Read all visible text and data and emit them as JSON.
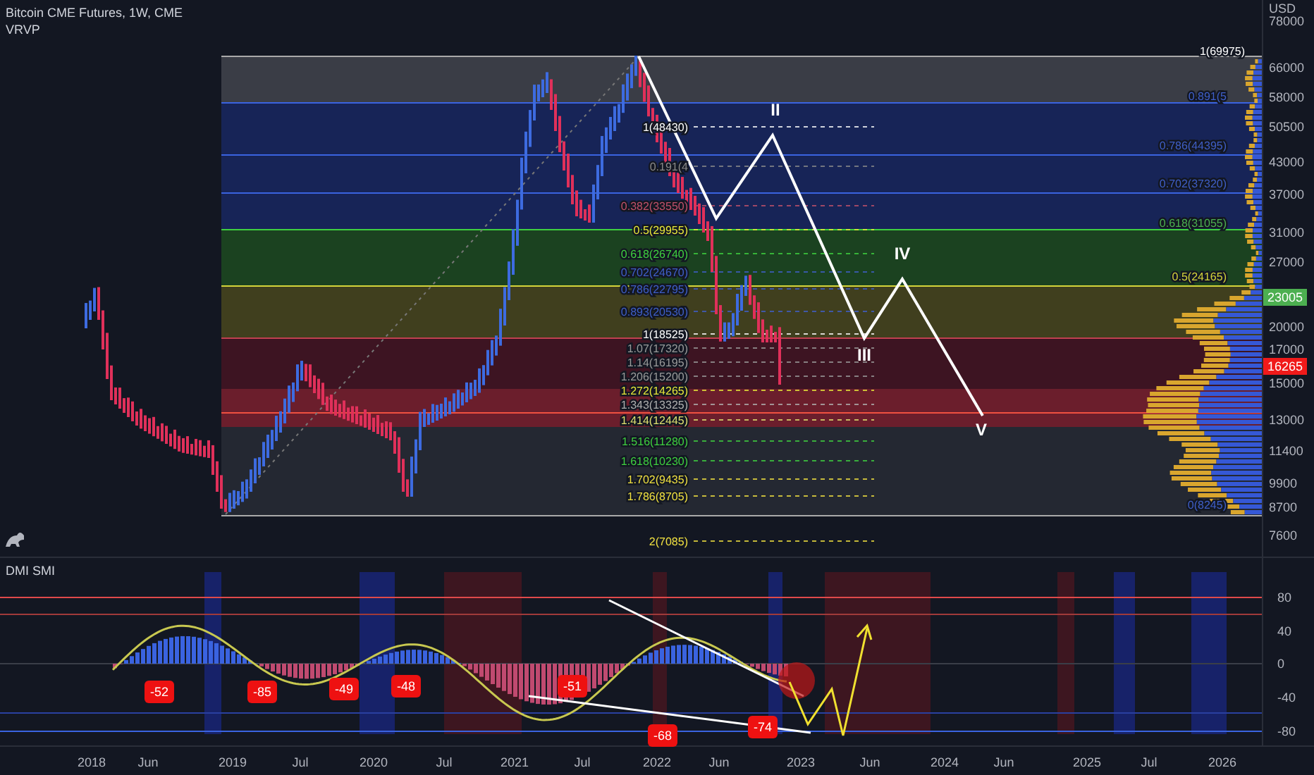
{
  "main_chart": {
    "title": "Bitcoin CME Futures, 1W, CME",
    "indicator": "VRVP",
    "outer_fib_labels": [
      {
        "text": "1(69975)",
        "color": "#ffffff"
      },
      {
        "text": "0.891(5",
        "color": "#3f5fc8"
      },
      {
        "text": "0.786(44395)",
        "color": "#3f5fc8"
      },
      {
        "text": "0.702(37320)",
        "color": "#3f5fc8"
      },
      {
        "text": "0.618(31055)",
        "color": "#4caf50"
      },
      {
        "text": "0.5(24165)",
        "color": "#d4d43a"
      },
      {
        "text": "0(8245)",
        "color": "#3f5fc8"
      }
    ],
    "inner_fib_labels": [
      {
        "text": "1(48430)",
        "color": "#ffffff"
      },
      {
        "text": "0.191(4",
        "color": "#8a8a8a"
      },
      {
        "text": "0.382(33550)",
        "color": "#c0506a"
      },
      {
        "text": "0.5(29955)",
        "color": "#e8e83a"
      },
      {
        "text": "0.618(26740)",
        "color": "#3fd03f"
      },
      {
        "text": "0.702(24670)",
        "color": "#3f5fc8"
      },
      {
        "text": "0.786(22795)",
        "color": "#3f5fc8"
      },
      {
        "text": "0.893(20530)",
        "color": "#3f5fc8"
      },
      {
        "text": "1(18525)",
        "color": "#ffffff"
      },
      {
        "text": "1.07(17320)",
        "color": "#9a9a9a"
      },
      {
        "text": "1.14(16195)",
        "color": "#9a9a9a"
      },
      {
        "text": "1.206(15200)",
        "color": "#9a9a9a"
      },
      {
        "text": "1.272(14265)",
        "color": "#e8e83a"
      },
      {
        "text": "1.343(13325)",
        "color": "#b0b0b0"
      },
      {
        "text": "1.414(12445)",
        "color": "#e0e070"
      },
      {
        "text": "1.516(11280)",
        "color": "#3fd03f"
      },
      {
        "text": "1.618(10230)",
        "color": "#3fd03f"
      },
      {
        "text": "1.702(9435)",
        "color": "#f0e040"
      },
      {
        "text": "1.786(8705)",
        "color": "#f0e040"
      },
      {
        "text": "2(7085)",
        "color": "#f0e040"
      }
    ],
    "wave_labels": [
      "II",
      "III",
      "IV",
      "V"
    ],
    "price_axis": {
      "unit": "USD",
      "ticks": [
        "78000",
        "66000",
        "58000",
        "50500",
        "43000",
        "37000",
        "31000",
        "27000",
        "20000",
        "17000",
        "15000",
        "13000",
        "11400",
        "9900",
        "8700",
        "7600"
      ],
      "badges": [
        {
          "text": "23005",
          "color": "#4caf50"
        },
        {
          "text": "16265",
          "color": "#f01a1a"
        }
      ]
    }
  },
  "indicator_pane": {
    "title": "DMI SMI",
    "ticks": [
      "80",
      "40",
      "0",
      "-40",
      "-80"
    ],
    "value_badges": [
      "-52",
      "-85",
      "-49",
      "-48",
      "-51",
      "-68",
      "-74"
    ]
  },
  "time_axis": [
    "2018",
    "Jun",
    "2019",
    "Jul",
    "2020",
    "Jul",
    "2021",
    "Jul",
    "2022",
    "Jun",
    "2023",
    "Jun",
    "2024",
    "Jun",
    "2025",
    "Jul",
    "2026"
  ]
}
